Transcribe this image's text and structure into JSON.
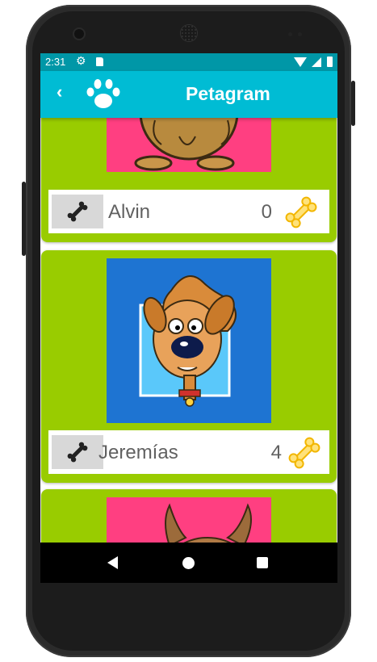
{
  "status_bar": {
    "time": "2:31"
  },
  "app_bar": {
    "title": "Petagram"
  },
  "pets": [
    {
      "name": "Alvin",
      "likes": "0"
    },
    {
      "name": "Jeremías",
      "likes": "4"
    }
  ],
  "colors": {
    "primary": "#00bcd4",
    "primary_dark": "#0097a7",
    "card": "#99cc00",
    "like": "#ffd23f"
  }
}
